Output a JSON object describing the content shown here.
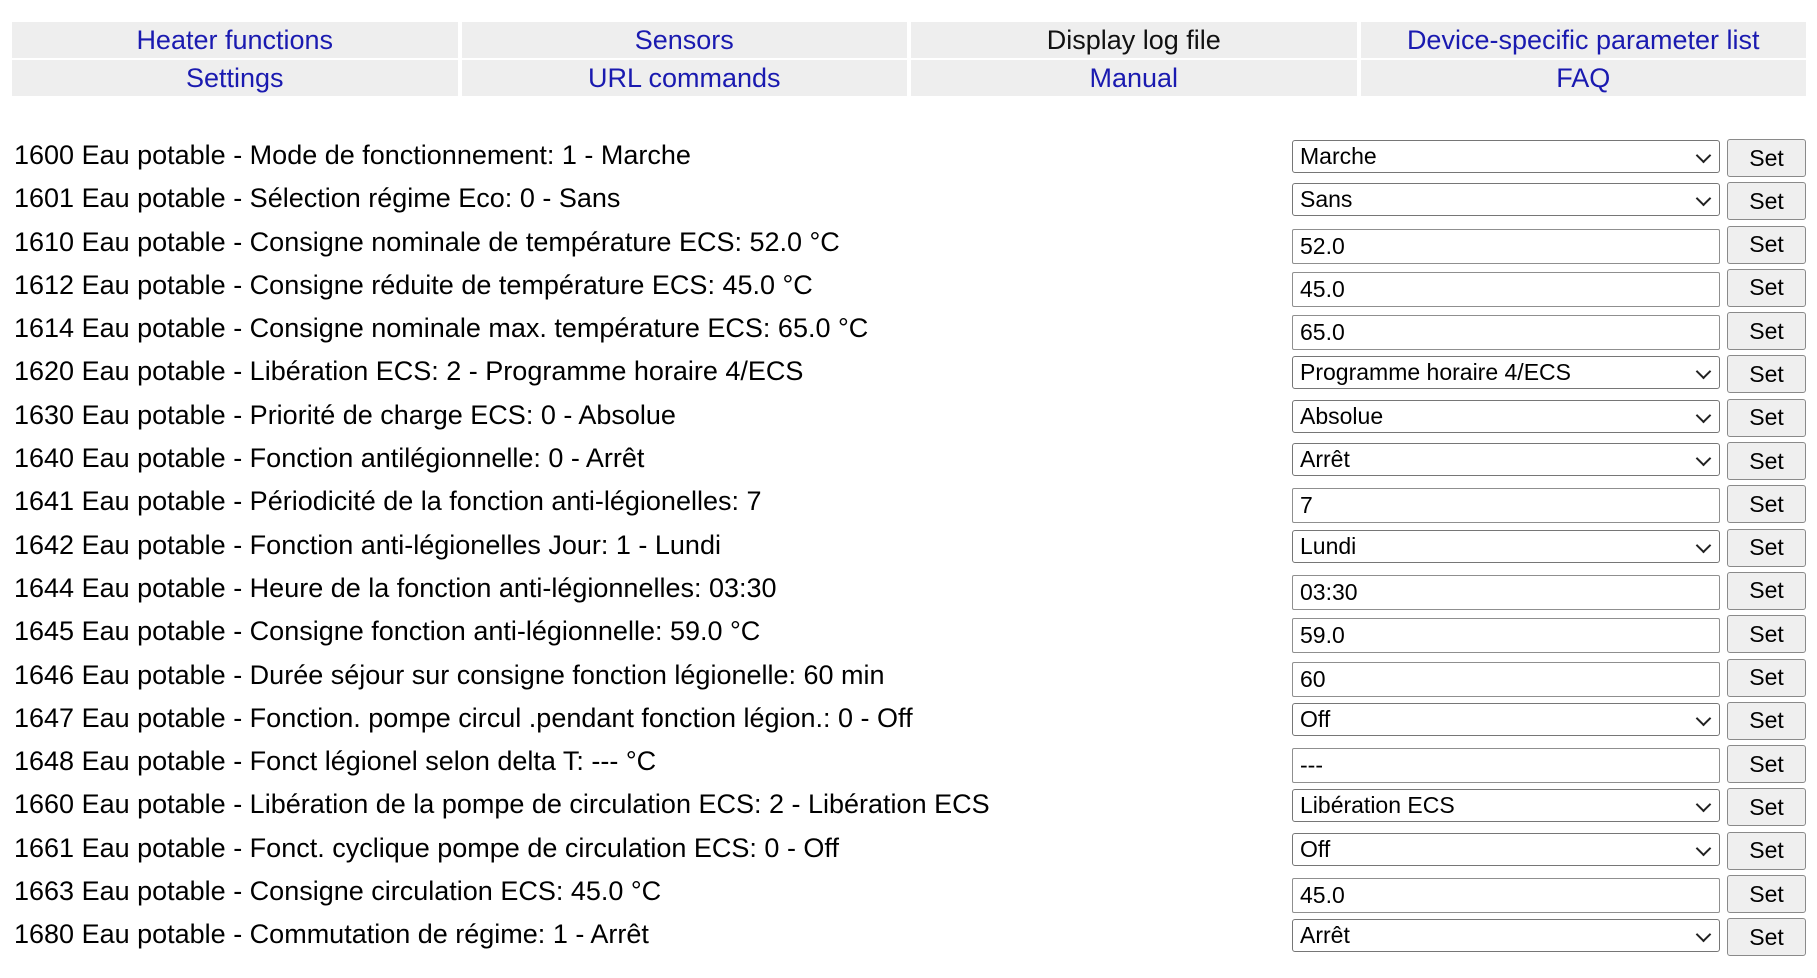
{
  "nav": {
    "items": [
      {
        "label": "Heater functions",
        "current": false
      },
      {
        "label": "Sensors",
        "current": false
      },
      {
        "label": "Display log file",
        "current": true
      },
      {
        "label": "Device-specific parameter list",
        "current": false
      },
      {
        "label": "Settings",
        "current": false
      },
      {
        "label": "URL commands",
        "current": false
      },
      {
        "label": "Manual",
        "current": false
      },
      {
        "label": "FAQ",
        "current": false
      }
    ]
  },
  "colors": {
    "link": "#1a1ab0",
    "nav_background": "#eeeeee",
    "button_background": "#efefef"
  },
  "set_label": "Set",
  "rows": [
    {
      "label": "1600 Eau potable - Mode de fonctionnement: 1 - Marche",
      "control": "select",
      "value": "Marche"
    },
    {
      "label": "1601 Eau potable - Sélection régime Eco: 0 - Sans",
      "control": "select",
      "value": "Sans"
    },
    {
      "label": "1610 Eau potable - Consigne nominale de température ECS: 52.0 °C",
      "control": "text",
      "value": "52.0"
    },
    {
      "label": "1612 Eau potable - Consigne réduite de température ECS: 45.0 °C",
      "control": "text",
      "value": "45.0"
    },
    {
      "label": "1614 Eau potable - Consigne nominale max. température ECS: 65.0 °C",
      "control": "text",
      "value": "65.0"
    },
    {
      "label": "1620 Eau potable - Libération ECS: 2 - Programme horaire 4/ECS",
      "control": "select",
      "value": "Programme horaire 4/ECS"
    },
    {
      "label": "1630 Eau potable - Priorité de charge ECS: 0 - Absolue",
      "control": "select",
      "value": "Absolue"
    },
    {
      "label": "1640 Eau potable - Fonction antilégionnelle: 0 - Arrêt",
      "control": "select",
      "value": "Arrêt"
    },
    {
      "label": "1641 Eau potable - Périodicité de la fonction anti-légionelles: 7",
      "control": "text",
      "value": "7"
    },
    {
      "label": "1642 Eau potable - Fonction anti-légionelles Jour: 1 - Lundi",
      "control": "select",
      "value": "Lundi"
    },
    {
      "label": "1644 Eau potable - Heure de la fonction anti-légionnelles: 03:30",
      "control": "text",
      "value": "03:30"
    },
    {
      "label": "1645 Eau potable - Consigne fonction anti-légionnelle: 59.0 °C",
      "control": "text",
      "value": "59.0"
    },
    {
      "label": "1646 Eau potable - Durée séjour sur consigne fonction légionelle: 60 min",
      "control": "text",
      "value": "60"
    },
    {
      "label": "1647 Eau potable - Fonction. pompe circul .pendant fonction légion.: 0 - Off",
      "control": "select",
      "value": "Off"
    },
    {
      "label": "1648 Eau potable - Fonct légionel selon delta T: --- °C",
      "control": "text",
      "value": "---"
    },
    {
      "label": "1660 Eau potable - Libération de la pompe de circulation ECS: 2 - Libération ECS",
      "control": "select",
      "value": "Libération ECS"
    },
    {
      "label": "1661 Eau potable - Fonct. cyclique pompe de circulation ECS: 0 - Off",
      "control": "select",
      "value": "Off"
    },
    {
      "label": "1663 Eau potable - Consigne circulation ECS: 45.0 °C",
      "control": "text",
      "value": "45.0"
    },
    {
      "label": "1680 Eau potable - Commutation de régime: 1 - Arrêt",
      "control": "select",
      "value": "Arrêt"
    }
  ]
}
